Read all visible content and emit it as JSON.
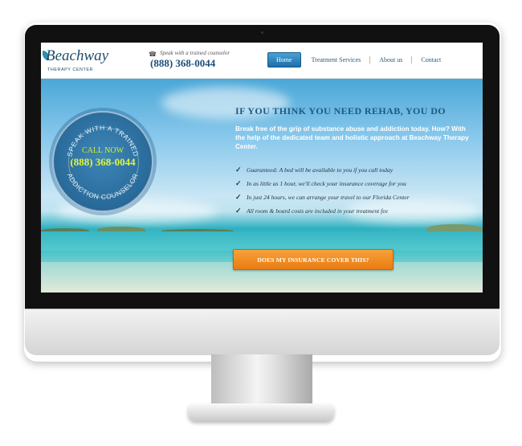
{
  "logo": {
    "wordmark": "Beachway",
    "subtitle": "THERAPY CENTER"
  },
  "header": {
    "tagline": "Speak with a trained counselor",
    "phone": "(888) 368-0044"
  },
  "nav": {
    "items": [
      {
        "label": "Home",
        "active": true
      },
      {
        "label": "Treatment Services",
        "active": false
      },
      {
        "label": "About us",
        "active": false
      },
      {
        "label": "Contact",
        "active": false
      }
    ]
  },
  "badge": {
    "top_arc": "SPEAK WITH A TRAINED",
    "bottom_arc": "ADDICTION COUNSELOR",
    "call_label": "CALL NOW",
    "phone": "(888) 368-0044"
  },
  "hero": {
    "headline": "IF YOU THINK YOU NEED REHAB, YOU DO",
    "lead": "Break free of the grip of substance abuse and addiction today. How? With the help of the dedicated team and holistic approach at Beachway Therapy Center.",
    "checks": [
      "Guaranteed: A bed will be available to you if you call today",
      "In as little as 1 hour, we'll check your insurance coverage for you",
      "In just 24 hours, we can arrange your travel to our Florida Center",
      "All room & board costs are included in your treatment fee"
    ],
    "cta": "DOES MY INSURANCE COVER THIS?"
  },
  "colors": {
    "brand_blue": "#1f4e7a",
    "cta_orange": "#ef8a1f",
    "badge_green": "#d6ef2a"
  },
  "icons": {
    "phone": "phone-icon",
    "check": "checkmark-icon"
  }
}
